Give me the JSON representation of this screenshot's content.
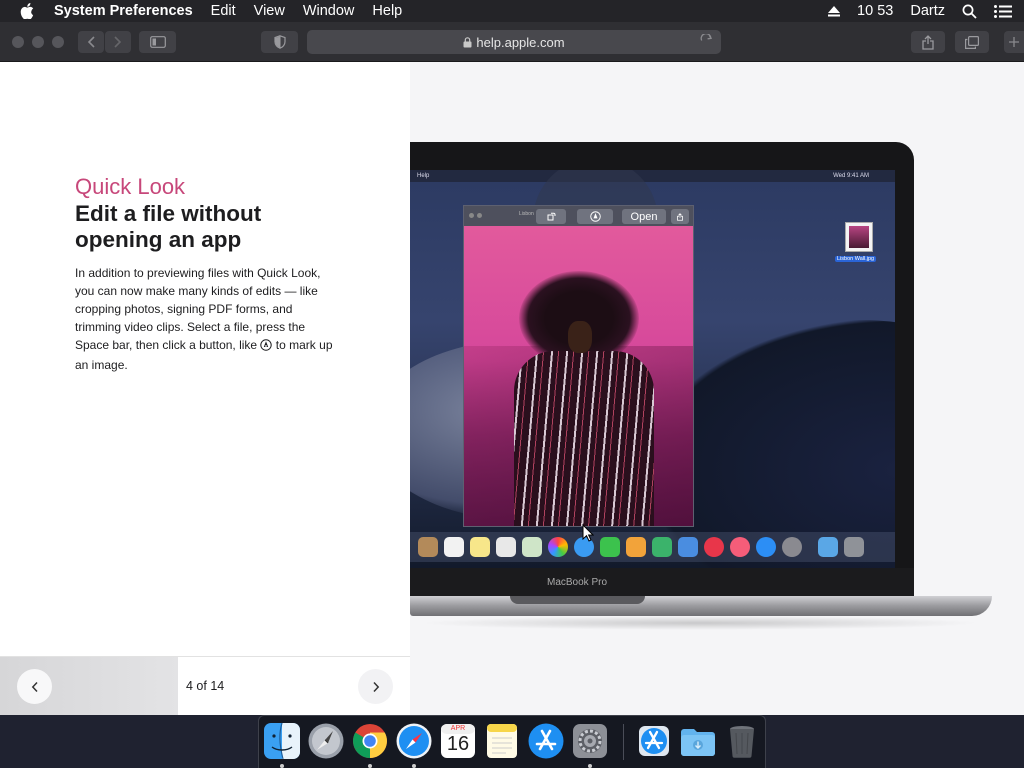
{
  "menubar": {
    "app_name": "System Preferences",
    "menus": [
      "Edit",
      "View",
      "Window",
      "Help"
    ],
    "clock": "10 53",
    "user": "Dartz"
  },
  "toolbar": {
    "url": "help.apple.com"
  },
  "article": {
    "eyebrow": "Quick Look",
    "headline": "Edit a file without opening an app",
    "body_before_icon": "In addition to previewing files with Quick Look, you can now make many kinds of edits — like cropping photos, signing PDF forms, and trimming video clips. Select a file, press the Space bar, then click a button, like",
    "body_after_icon": "to mark up an image."
  },
  "pager": {
    "counter": "4 of 14"
  },
  "illustration": {
    "mini_menu": "Help",
    "mini_clock": "Wed 9:41 AM",
    "ql_filename": "Lisbon",
    "open_button": "Open",
    "desktop_file_label": "Lisbon Wall.jpg",
    "laptop_label": "MacBook Pro"
  },
  "dock": {
    "apps": [
      "finder",
      "launchpad",
      "chrome",
      "safari",
      "calendar",
      "notes",
      "app-store",
      "system-preferences"
    ],
    "calendar_month": "APR",
    "calendar_day": "16",
    "extras": [
      "app-store-download",
      "downloads-folder",
      "trash"
    ]
  },
  "colors": {
    "accent_pink": "#c7477a",
    "menubar_bg": "#242428",
    "toolbar_bg": "#2f2f33"
  }
}
